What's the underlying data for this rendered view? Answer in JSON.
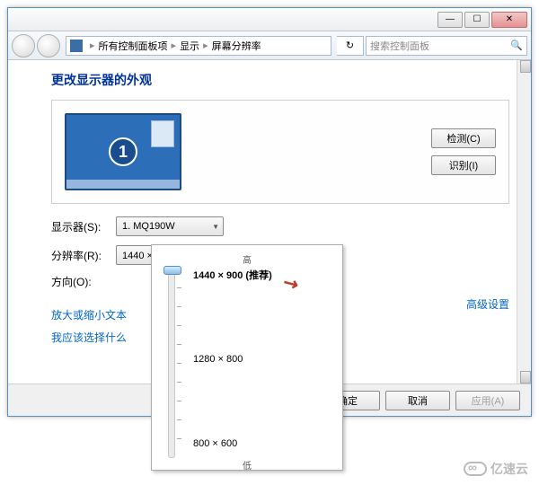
{
  "titlebar": {
    "minimize": "—",
    "maximize": "☐",
    "close": "✕"
  },
  "breadcrumb": {
    "item1": "所有控制面板项",
    "item2": "显示",
    "item3": "屏幕分辨率",
    "sep": "▸"
  },
  "search": {
    "placeholder": "搜索控制面板",
    "icon": "🔍"
  },
  "heading": "更改显示器的外观",
  "monitor": {
    "number": "1"
  },
  "buttons": {
    "detect": "检测(C)",
    "identify": "识别(I)"
  },
  "form": {
    "display_label": "显示器(S):",
    "display_value": "1. MQ190W",
    "resolution_label": "分辨率(R):",
    "resolution_value": "1440 × 900 (推荐)",
    "orientation_label": "方向(O):"
  },
  "links": {
    "text_size": "放大或缩小文本",
    "help": "我应该选择什么",
    "advanced": "高级设置"
  },
  "dialog_buttons": {
    "ok": "确定",
    "cancel": "取消",
    "apply": "应用(A)"
  },
  "res_popup": {
    "high": "高",
    "low": "低",
    "options": [
      {
        "label": "1440 × 900 (推荐)",
        "pos": 0,
        "current": true
      },
      {
        "label": "1280 × 800",
        "pos": 96
      },
      {
        "label": "800 × 600",
        "pos": 190
      }
    ]
  },
  "watermark": "亿速云"
}
